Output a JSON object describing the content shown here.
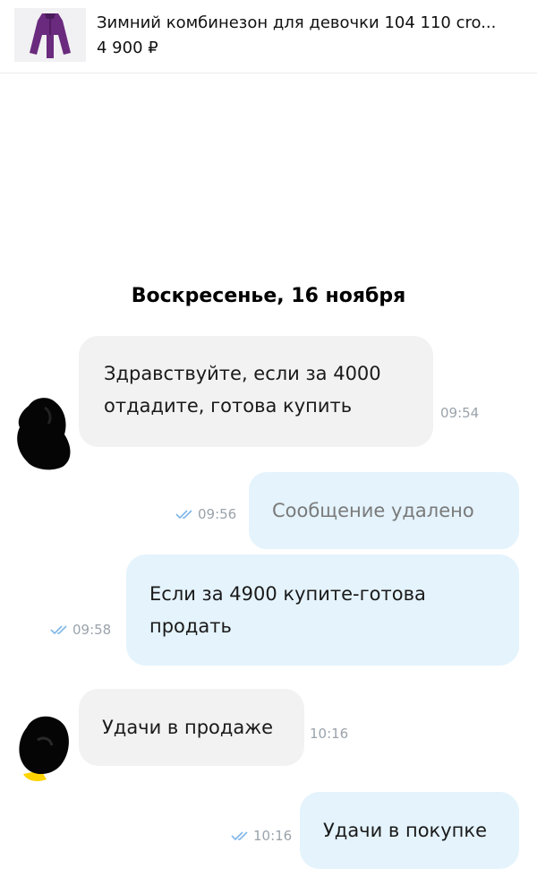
{
  "product": {
    "title": "Зимний комбинезон для девочки 104 110 cro...",
    "price": "4 900 ₽",
    "thumbnail_icon": "jumpsuit-image"
  },
  "chat": {
    "date_separator": "Воскресенье, 16 ноября",
    "messages": [
      {
        "direction": "incoming",
        "text_line1": "Здравствуйте, если за 4000",
        "text_line2": "отдадите, готова купить",
        "time": "09:54"
      },
      {
        "direction": "outgoing",
        "text": "Сообщение удалено",
        "time": "09:56",
        "status": "read",
        "deleted": true
      },
      {
        "direction": "outgoing",
        "text_line1": "Если за 4900 купите-готова",
        "text_line2": "продать",
        "time": "09:58",
        "status": "read"
      },
      {
        "direction": "incoming",
        "text": "Удачи в продаже",
        "time": "10:16"
      },
      {
        "direction": "outgoing",
        "text": "Удачи в покупке",
        "time": "10:16",
        "status": "read"
      }
    ]
  },
  "colors": {
    "incoming_bubble": "#f2f2f2",
    "outgoing_bubble": "#e4f3fc",
    "read_check": "#7fb6e8",
    "timestamp": "#9aa3ab"
  }
}
